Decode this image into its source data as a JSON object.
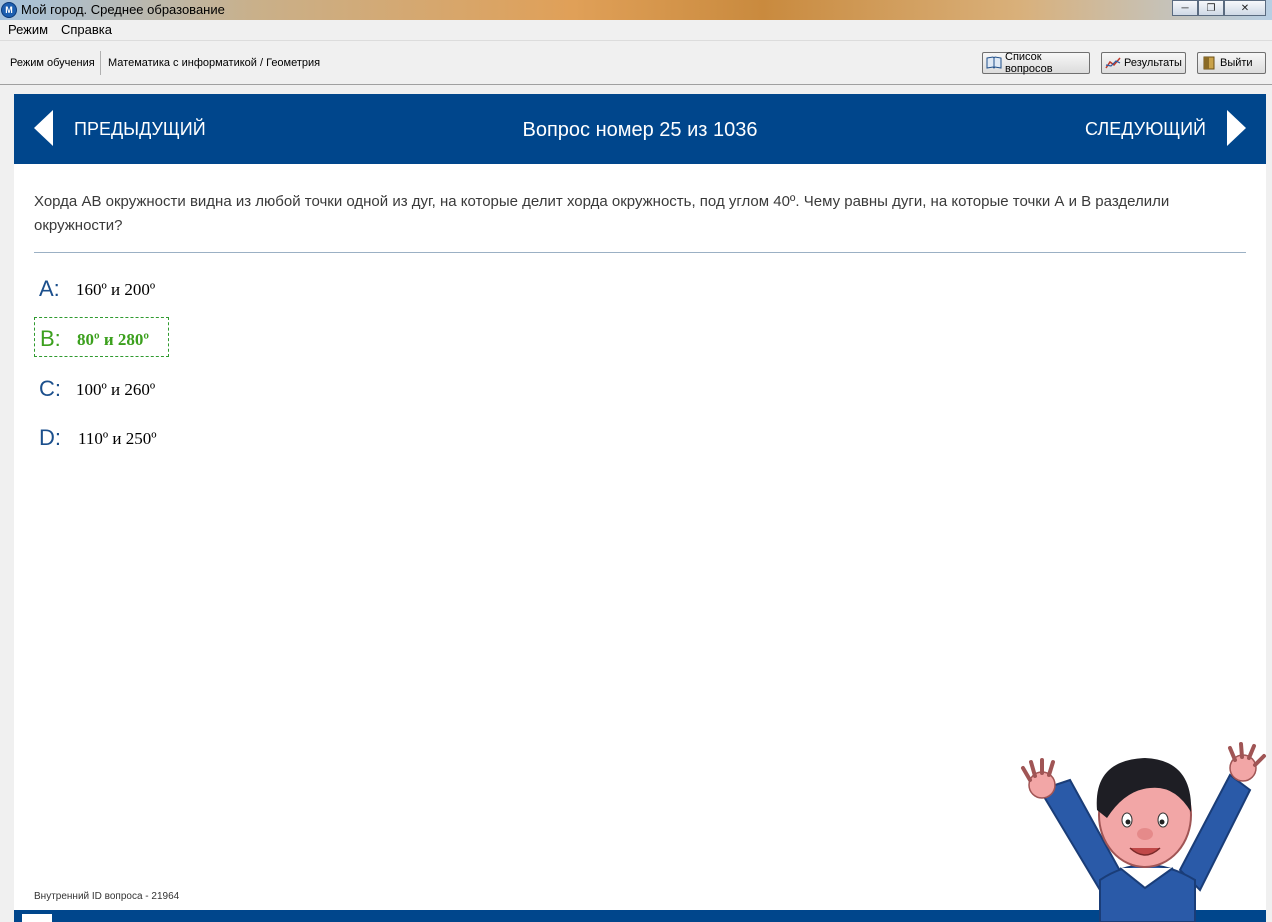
{
  "window": {
    "title": "Мой город. Среднее образование",
    "controls": [
      "minimize",
      "maximize",
      "close"
    ]
  },
  "menu": {
    "items": [
      "Режим",
      "Справка"
    ]
  },
  "toolbar": {
    "mode": "Режим обучения",
    "subject": "Математика с информатикой / Геометрия",
    "buttons": {
      "questions_list": "Список вопросов",
      "results": "Результаты",
      "exit": "Выйти"
    }
  },
  "nav": {
    "prev": "ПРЕДЫДУЩИЙ",
    "next": "СЛЕДУЮЩИЙ",
    "question_number": "Вопрос номер 25 из 1036"
  },
  "question": {
    "text": "Хорда АВ окружности видна из любой точки одной из дуг, на которые делит хорда окружность, под углом 40º. Чему равны дуги, на которые точки А и В разделили окружности?",
    "answers": [
      {
        "letter": "A:",
        "text": "160º и 200º",
        "selected": false
      },
      {
        "letter": "B:",
        "text": "80º и 280º",
        "selected": true
      },
      {
        "letter": "C:",
        "text": "100º и 260º",
        "selected": false
      },
      {
        "letter": "D:",
        "text": "110º и 250º",
        "selected": false
      }
    ]
  },
  "footer": {
    "internal_id": "Внутренний ID вопроса - 21964"
  },
  "colors": {
    "nav_blue": "#00468c",
    "selected_green": "#3ca01e",
    "letter_blue": "#1b4f8c"
  }
}
